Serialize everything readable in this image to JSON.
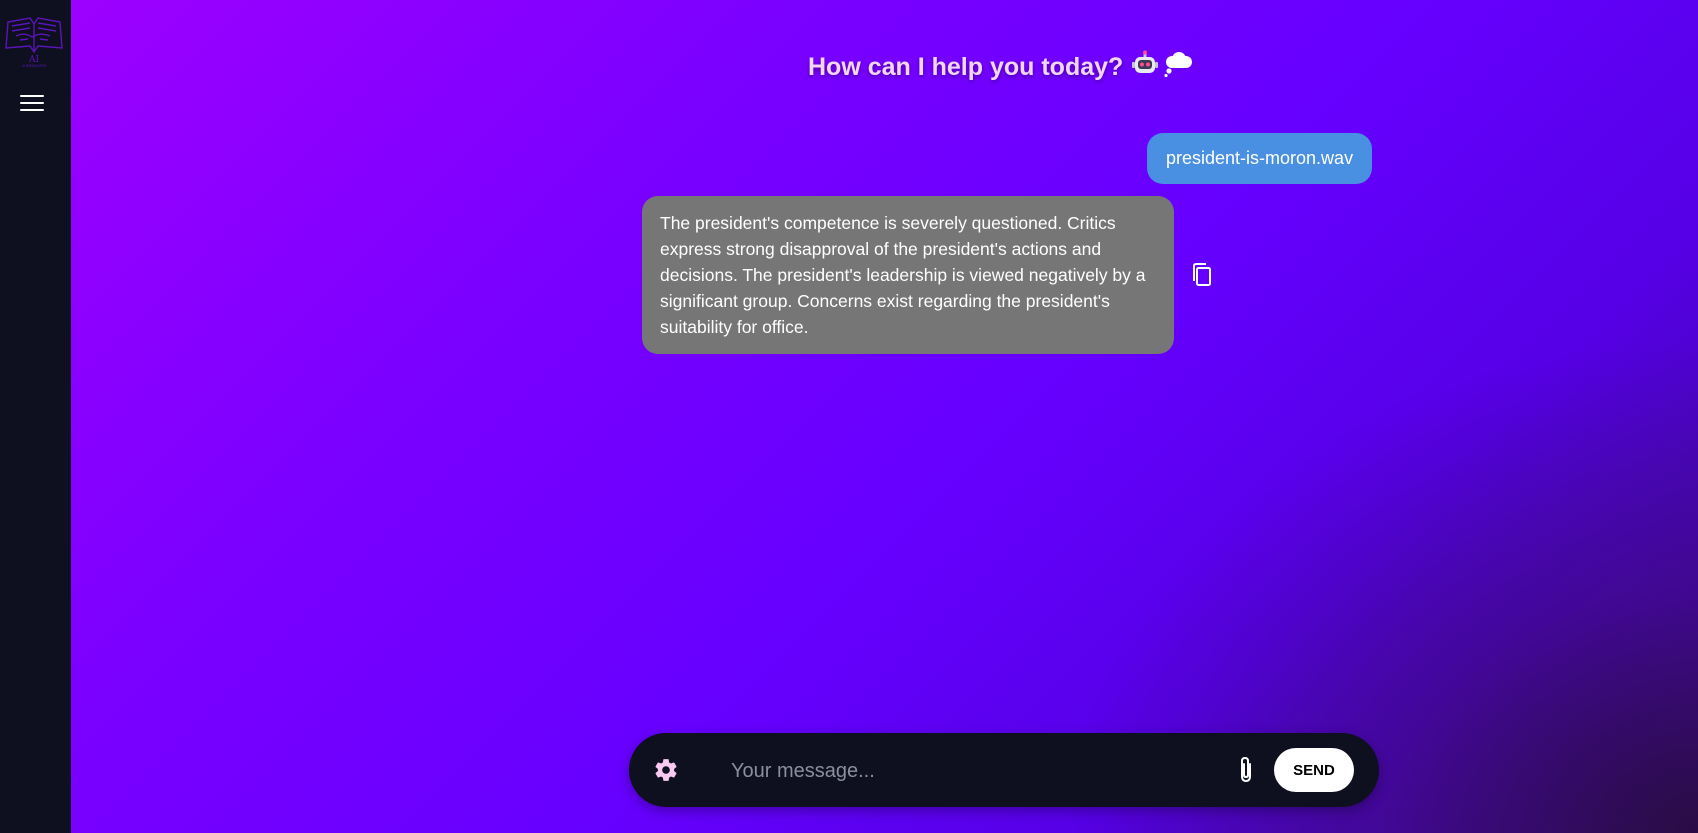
{
  "sidebar": {
    "logo_text": "AI",
    "logo_subtext": "SUMMARIZER",
    "menu_icon": "hamburger-menu-icon"
  },
  "header": {
    "title": "How can I help you today?",
    "emojis": [
      "robot-icon",
      "thought-bubble-icon"
    ]
  },
  "chat": {
    "messages": [
      {
        "role": "user",
        "text": "president-is-moron.wav"
      },
      {
        "role": "assistant",
        "text": "The president's competence is severely questioned. Critics express strong disapproval of the president's actions and decisions. The president's leadership is viewed negatively by a significant group. Concerns exist regarding the president's suitability for office.",
        "action_icon": "copy-icon"
      }
    ]
  },
  "composer": {
    "settings_icon": "gear-icon",
    "placeholder": "Your message...",
    "value": "",
    "attach_icon": "paperclip-icon",
    "send_label": "SEND"
  },
  "colors": {
    "sidebar_bg": "#0e101f",
    "gradient_start": "#9d00ff",
    "gradient_end": "#3a0a8c",
    "user_bubble": "#4a90e2",
    "assistant_bubble": "#767676",
    "heading_text": "#f3d6f5",
    "gear_icon": "#f8c9f0"
  }
}
